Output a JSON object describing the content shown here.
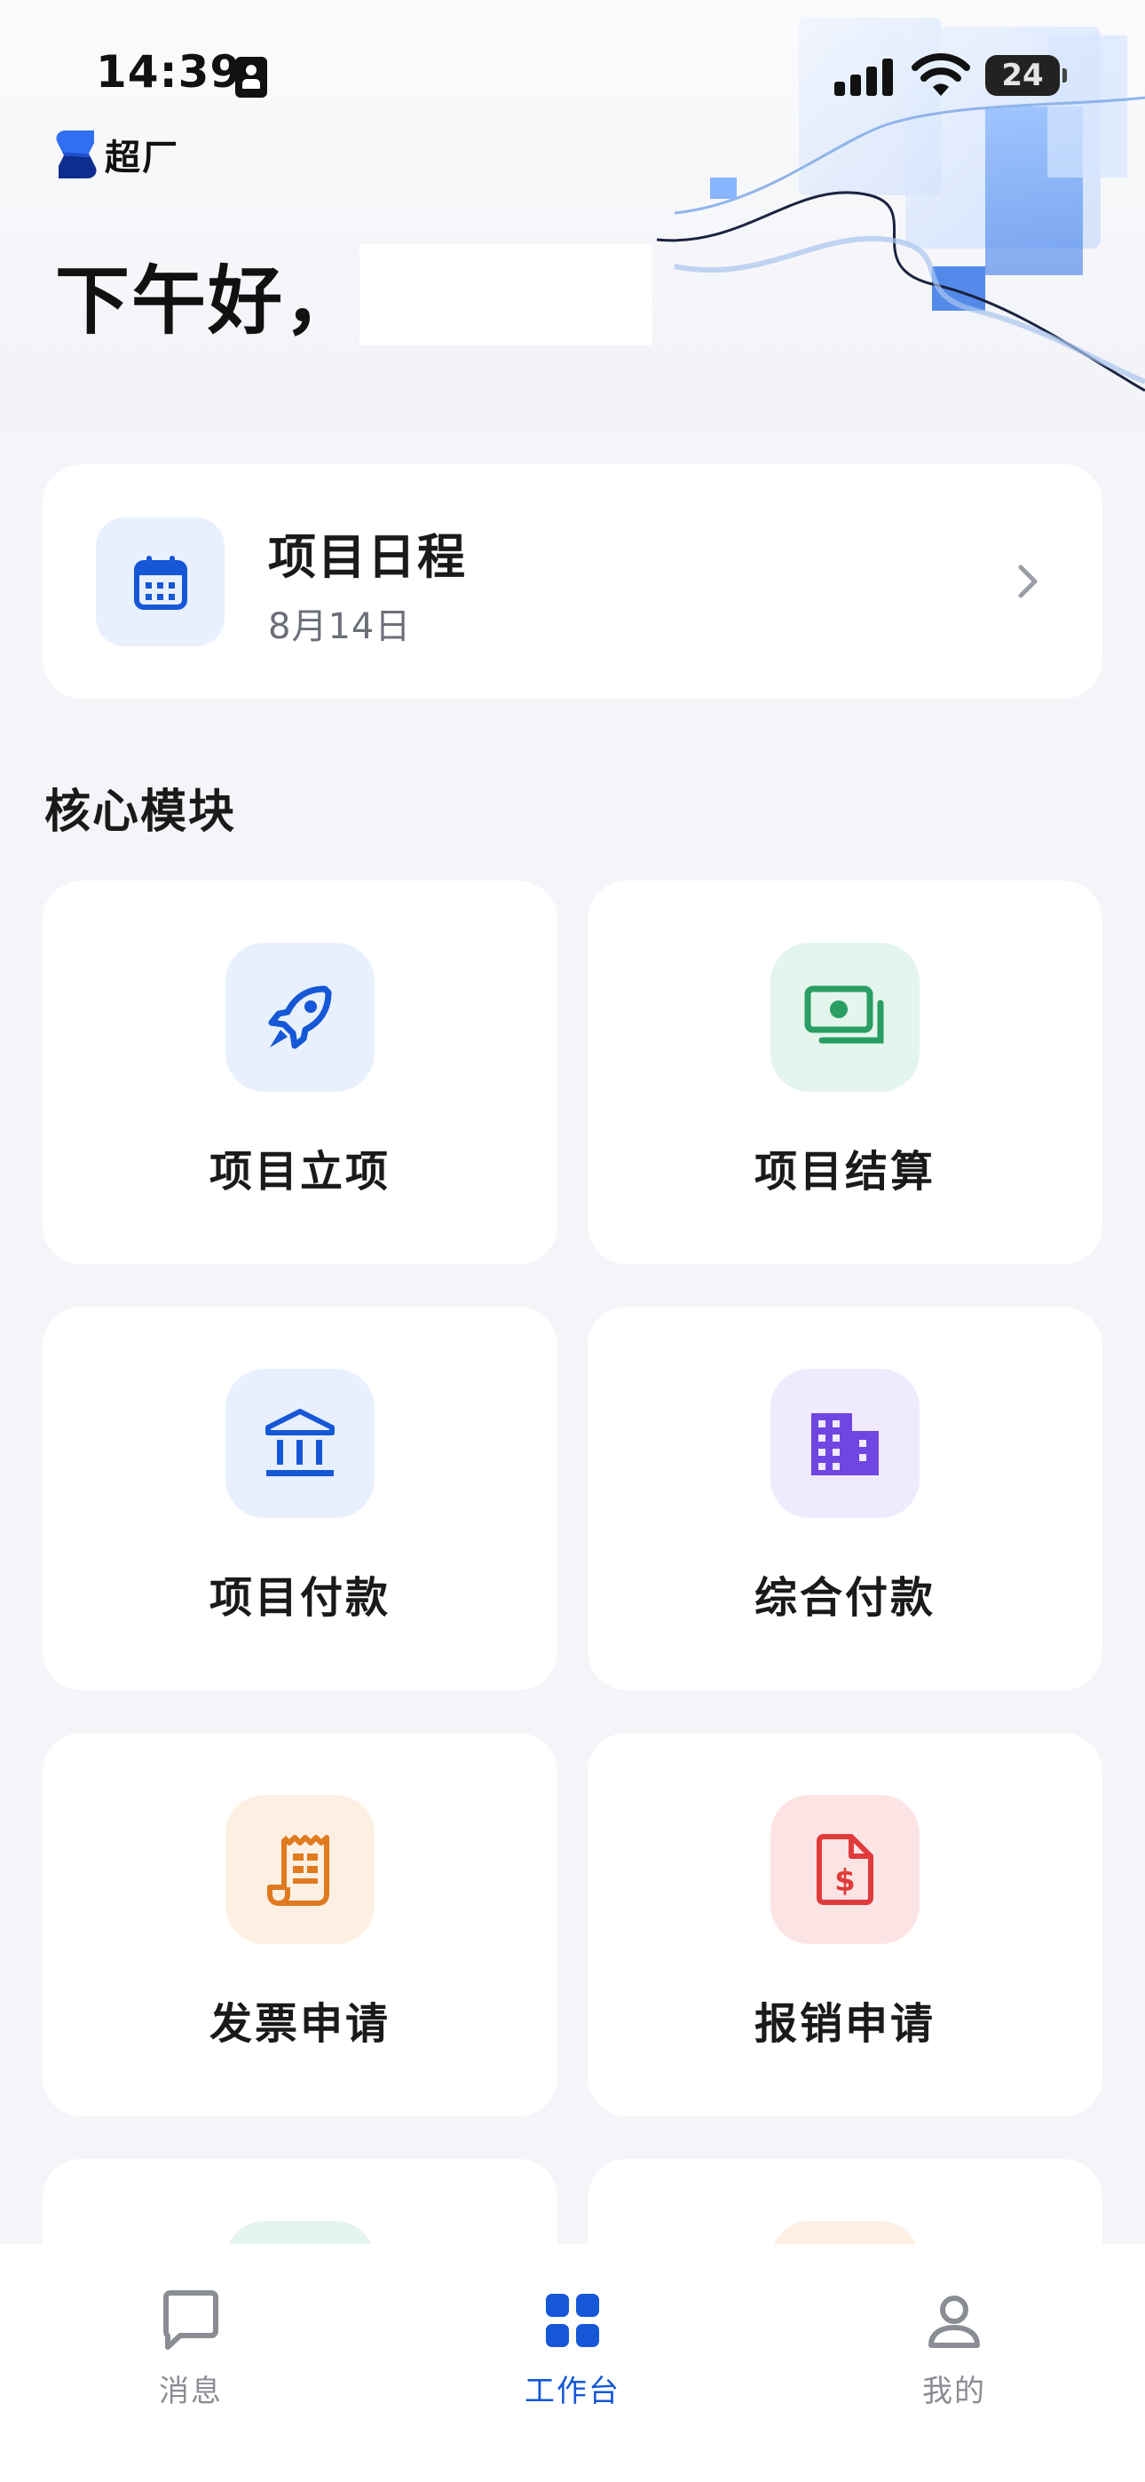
{
  "status_bar": {
    "time": "14:39",
    "battery": "24"
  },
  "header": {
    "logo_text": "超厂",
    "greeting": "下午好，"
  },
  "schedule": {
    "title": "项目日程",
    "date": "8月14日"
  },
  "section_title": "核心模块",
  "modules": [
    {
      "label": "项目立项",
      "icon": "rocket-icon",
      "bg": "#e8f0fe",
      "fg": "#1557d6"
    },
    {
      "label": "项目结算",
      "icon": "cash-icon",
      "bg": "#e3f5ec",
      "fg": "#2a9d63"
    },
    {
      "label": "项目付款",
      "icon": "bank-icon",
      "bg": "#e8f0fe",
      "fg": "#1557d6"
    },
    {
      "label": "综合付款",
      "icon": "building-icon",
      "bg": "#efeafd",
      "fg": "#7046e3"
    },
    {
      "label": "发票申请",
      "icon": "receipt-icon",
      "bg": "#fdf0e3",
      "fg": "#e07a1f"
    },
    {
      "label": "报销申请",
      "icon": "invoice-dollar-icon",
      "bg": "#fde4e4",
      "fg": "#e03b3b"
    }
  ],
  "partial_modules": [
    {
      "bg": "#e3f5ec"
    },
    {
      "bg": "#fdf0e3"
    }
  ],
  "tabbar": {
    "tabs": [
      {
        "label": "消息",
        "icon": "chat-icon",
        "active": false
      },
      {
        "label": "工作台",
        "icon": "grid-icon",
        "active": true
      },
      {
        "label": "我的",
        "icon": "user-icon",
        "active": false
      }
    ]
  },
  "colors": {
    "accent": "#1557d6",
    "background": "#f4f5f8",
    "card": "#ffffff",
    "muted_text": "#6b6f78",
    "tab_inactive": "#8a8d94"
  }
}
